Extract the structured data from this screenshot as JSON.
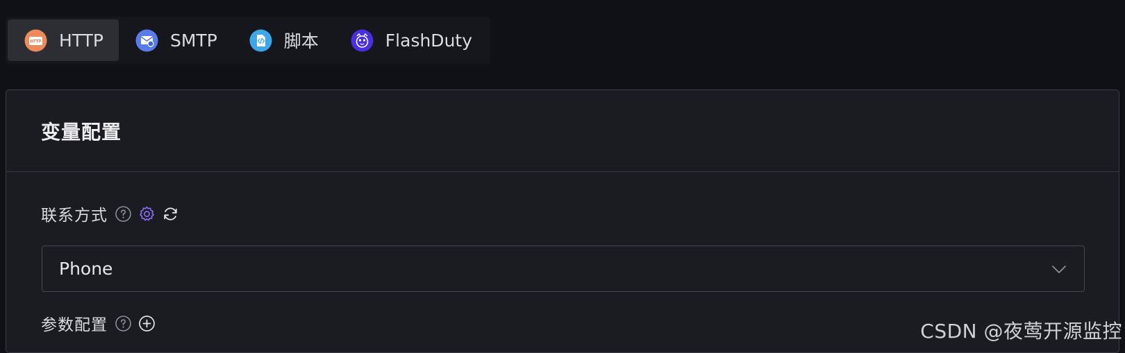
{
  "tabs": [
    {
      "label": "HTTP",
      "icon": "http-icon",
      "active": true
    },
    {
      "label": "SMTP",
      "icon": "smtp-mail-icon",
      "active": false
    },
    {
      "label": "脚本",
      "icon": "script-code-icon",
      "active": false
    },
    {
      "label": "FlashDuty",
      "icon": "flashduty-icon",
      "active": false
    }
  ],
  "card": {
    "title": "变量配置"
  },
  "contact": {
    "label": "联系方式",
    "help_icon": "help-circle-icon",
    "settings_icon": "gear-icon",
    "refresh_icon": "refresh-icon",
    "selected": "Phone",
    "chevron_icon": "chevron-down-icon"
  },
  "params": {
    "label": "参数配置",
    "help_icon": "help-circle-icon",
    "add_icon": "plus-circle-icon"
  },
  "watermark": "CSDN @夜莺开源监控",
  "colors": {
    "background": "#101117",
    "card": "#1b1c21",
    "accent": "#8b6cf6",
    "border": "#3b3c44"
  }
}
